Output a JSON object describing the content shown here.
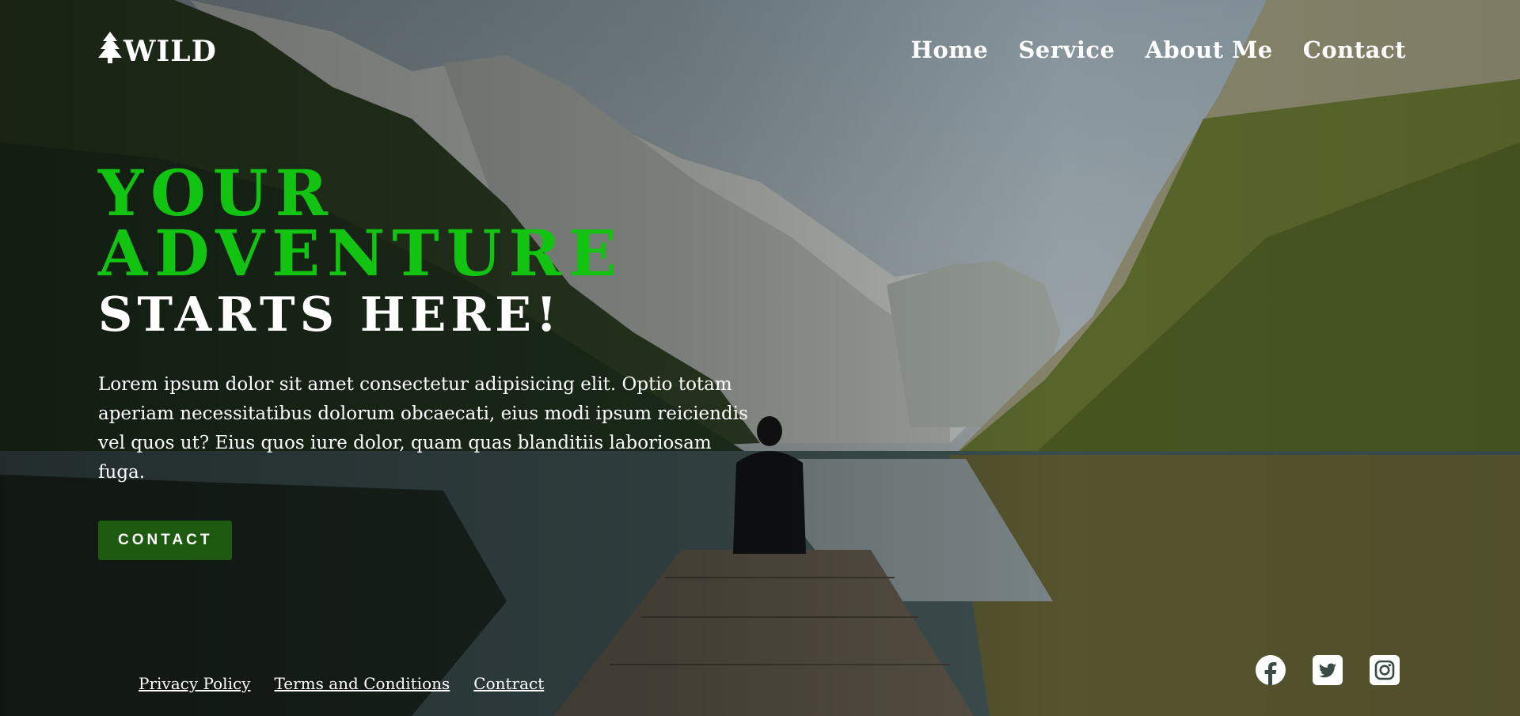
{
  "header": {
    "logo_text": "WILD",
    "logo_icon": "tree-icon",
    "nav": [
      "Home",
      "Service",
      "About Me",
      "Contact"
    ]
  },
  "hero": {
    "title_line1": "YOUR",
    "title_line2": "ADVENTURE",
    "title_line3": "STARTS HERE!",
    "paragraph": "Lorem ipsum dolor sit amet consectetur adipisicing elit. Optio totam aperiam necessitatibus dolorum obcaecati, eius modi ipsum reiciendis vel quos ut? Eius quos iure dolor, quam quas blanditiis laboriosam fuga.",
    "cta_label": "CONTACT"
  },
  "footer": {
    "links": [
      "Privacy Policy",
      "Terms and Conditions",
      "Contract"
    ],
    "social_icons": [
      "facebook-icon",
      "twitter-icon",
      "instagram-icon"
    ]
  },
  "colors": {
    "accent_green": "#12c312",
    "button_green": "#1d5a10",
    "text_white": "#ffffff"
  }
}
